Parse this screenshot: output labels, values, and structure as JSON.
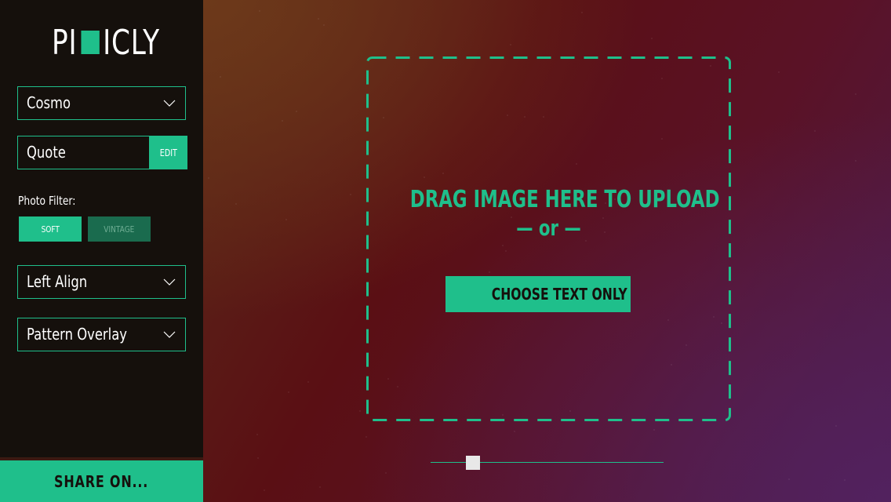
{
  "app": {
    "logo_left": "PI",
    "logo_right": "ICLY"
  },
  "sidebar": {
    "theme_select": {
      "value": "Cosmo",
      "icon": "chevron-down-icon"
    },
    "quote_field": {
      "value": "Quote",
      "edit_label": "EDIT"
    },
    "photo_filter": {
      "label": "Photo Filter:",
      "options": [
        {
          "label": "SOFT",
          "active": true
        },
        {
          "label": "VINTAGE",
          "active": false
        }
      ]
    },
    "align_select": {
      "value": "Left Align",
      "icon": "chevron-down-icon"
    },
    "overlay_select": {
      "value": "Pattern Overlay",
      "icon": "chevron-down-icon"
    },
    "share_label": "SHARE ON..."
  },
  "canvas": {
    "drag_text": "DRAG IMAGE HERE TO UPLOAD",
    "or_text": "— or —",
    "choose_label": "CHOOSE TEXT ONLY",
    "slider": {
      "value": 0.16
    }
  },
  "colors": {
    "accent": "#1fbf8b",
    "sidebar_bg": "#15100c",
    "vintage_btn": "#1a6b4e",
    "slider_thumb": "#e8e8e8"
  }
}
